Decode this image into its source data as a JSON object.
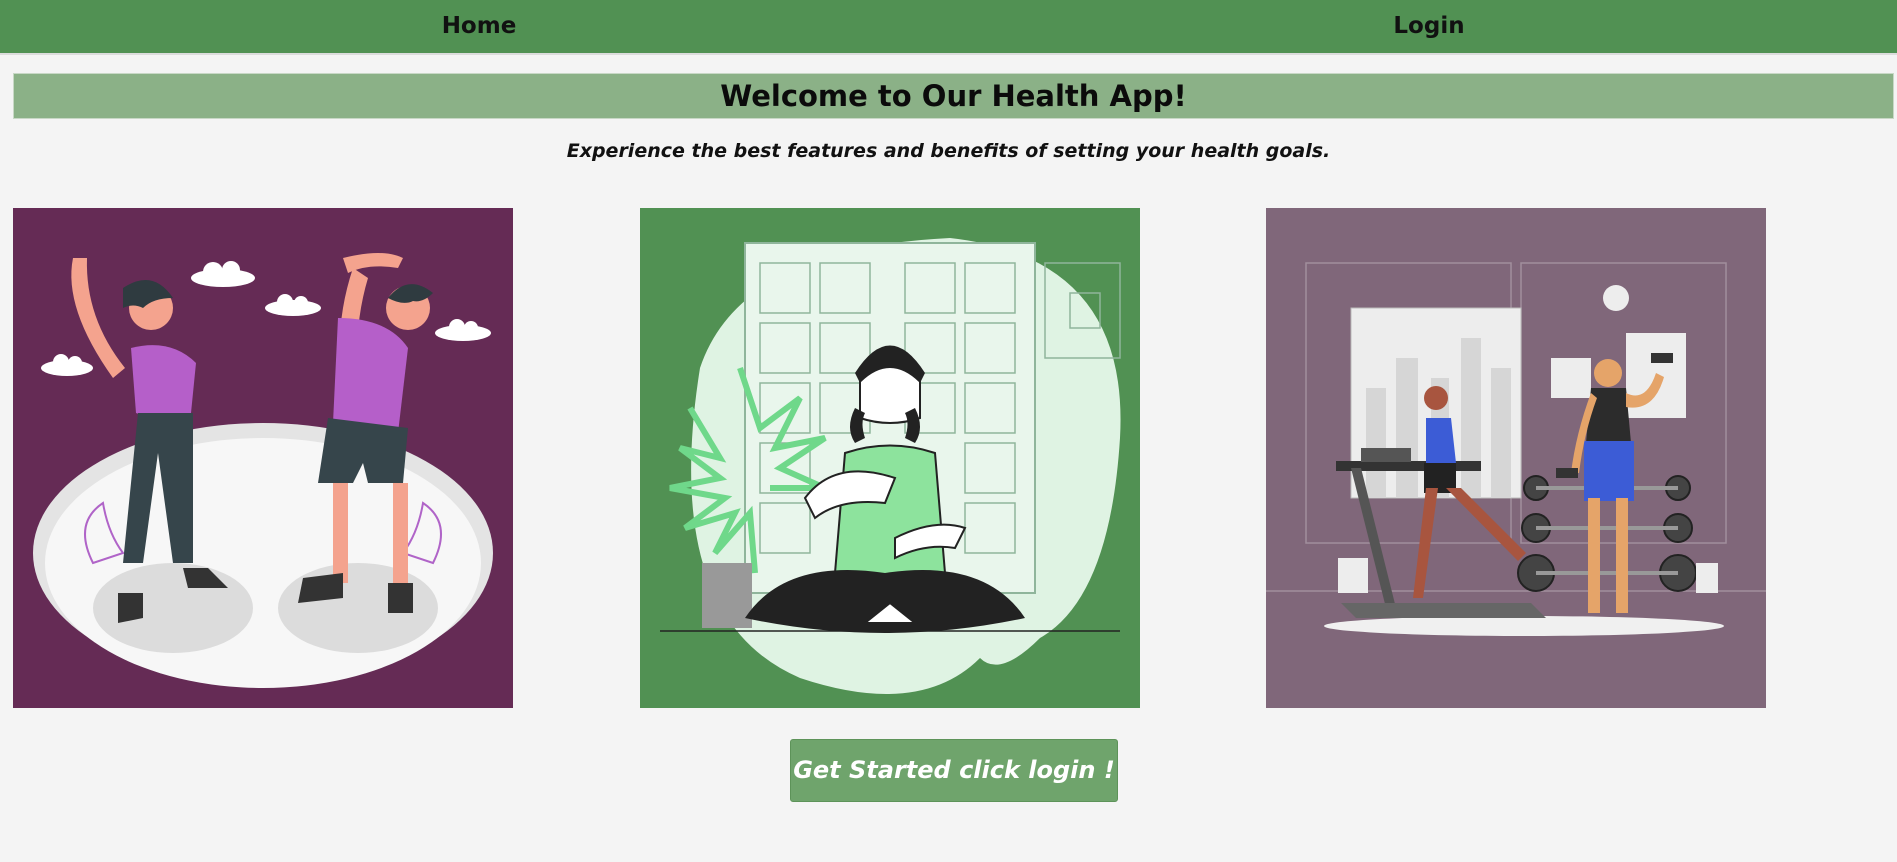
{
  "nav": {
    "home_label": "Home",
    "login_label": "Login"
  },
  "hero": {
    "title": "Welcome to Our Health App!",
    "subtitle": "Experience the best features and benefits of setting your health goals."
  },
  "cta": {
    "label": "Get Started click login !"
  },
  "colors": {
    "nav_bg": "#519153",
    "banner_bg": "#8bb187",
    "card1_bg": "#652b55",
    "card2_bg": "#519153",
    "card3_bg": "#80677a",
    "cta_bg": "#6fa46c"
  }
}
